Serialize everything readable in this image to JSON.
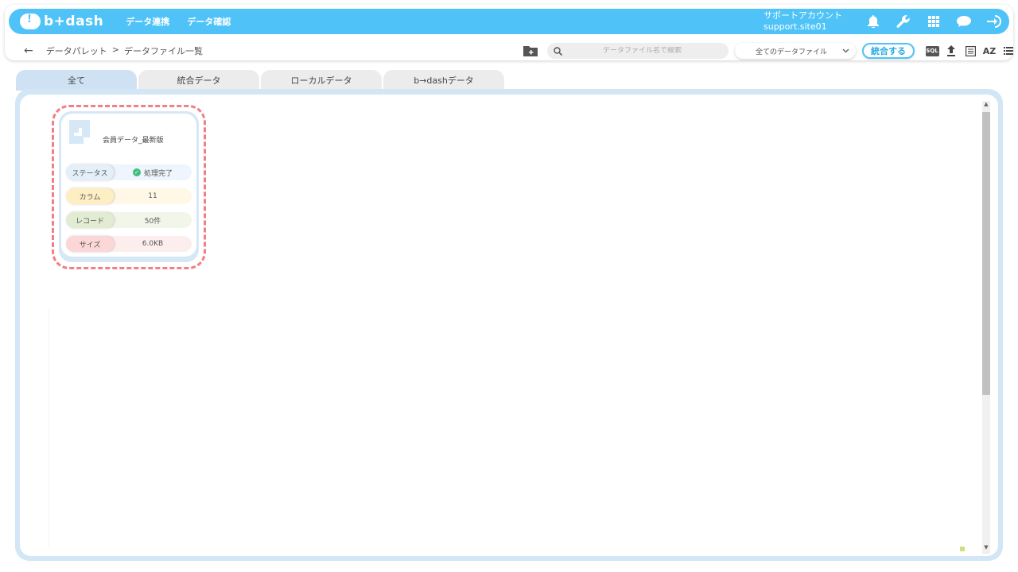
{
  "app": {
    "logo_text": "b+dash",
    "nav": [
      "データ連携",
      "データ確認"
    ],
    "account_name": "サポートアカウント",
    "account_site": "support.site01"
  },
  "toolbar": {
    "breadcrumb": [
      "データパレット",
      ">",
      "データファイル一覧"
    ],
    "search_placeholder": "データファイル名で検索",
    "filter_selected": "全てのデータファイル",
    "merge_label": "統合する",
    "sql_label": "SQL",
    "sort_label": "AZ"
  },
  "tabs": [
    "全て",
    "統合データ",
    "ローカルデータ",
    "b→dashデータ"
  ],
  "file_card": {
    "name": "会員データ_最新版",
    "rows": [
      {
        "label": "ステータス",
        "value": "処理完了"
      },
      {
        "label": "カラム",
        "value": "11"
      },
      {
        "label": "レコード",
        "value": "50件"
      },
      {
        "label": "サイズ",
        "value": "6.0KB"
      }
    ]
  },
  "colors": {
    "brand": "#4fc3f7",
    "highlight": "#f07f86",
    "status_ok": "#3cbf7a"
  },
  "icons": [
    "bell-icon",
    "wrench-icon",
    "grid-icon",
    "support-icon",
    "logout-icon",
    "folder-add-icon",
    "search-icon",
    "chevron-down-icon",
    "upload-icon",
    "list-view-icon",
    "sort-az-icon",
    "menu-icon",
    "document-icon",
    "check-circle-icon"
  ]
}
